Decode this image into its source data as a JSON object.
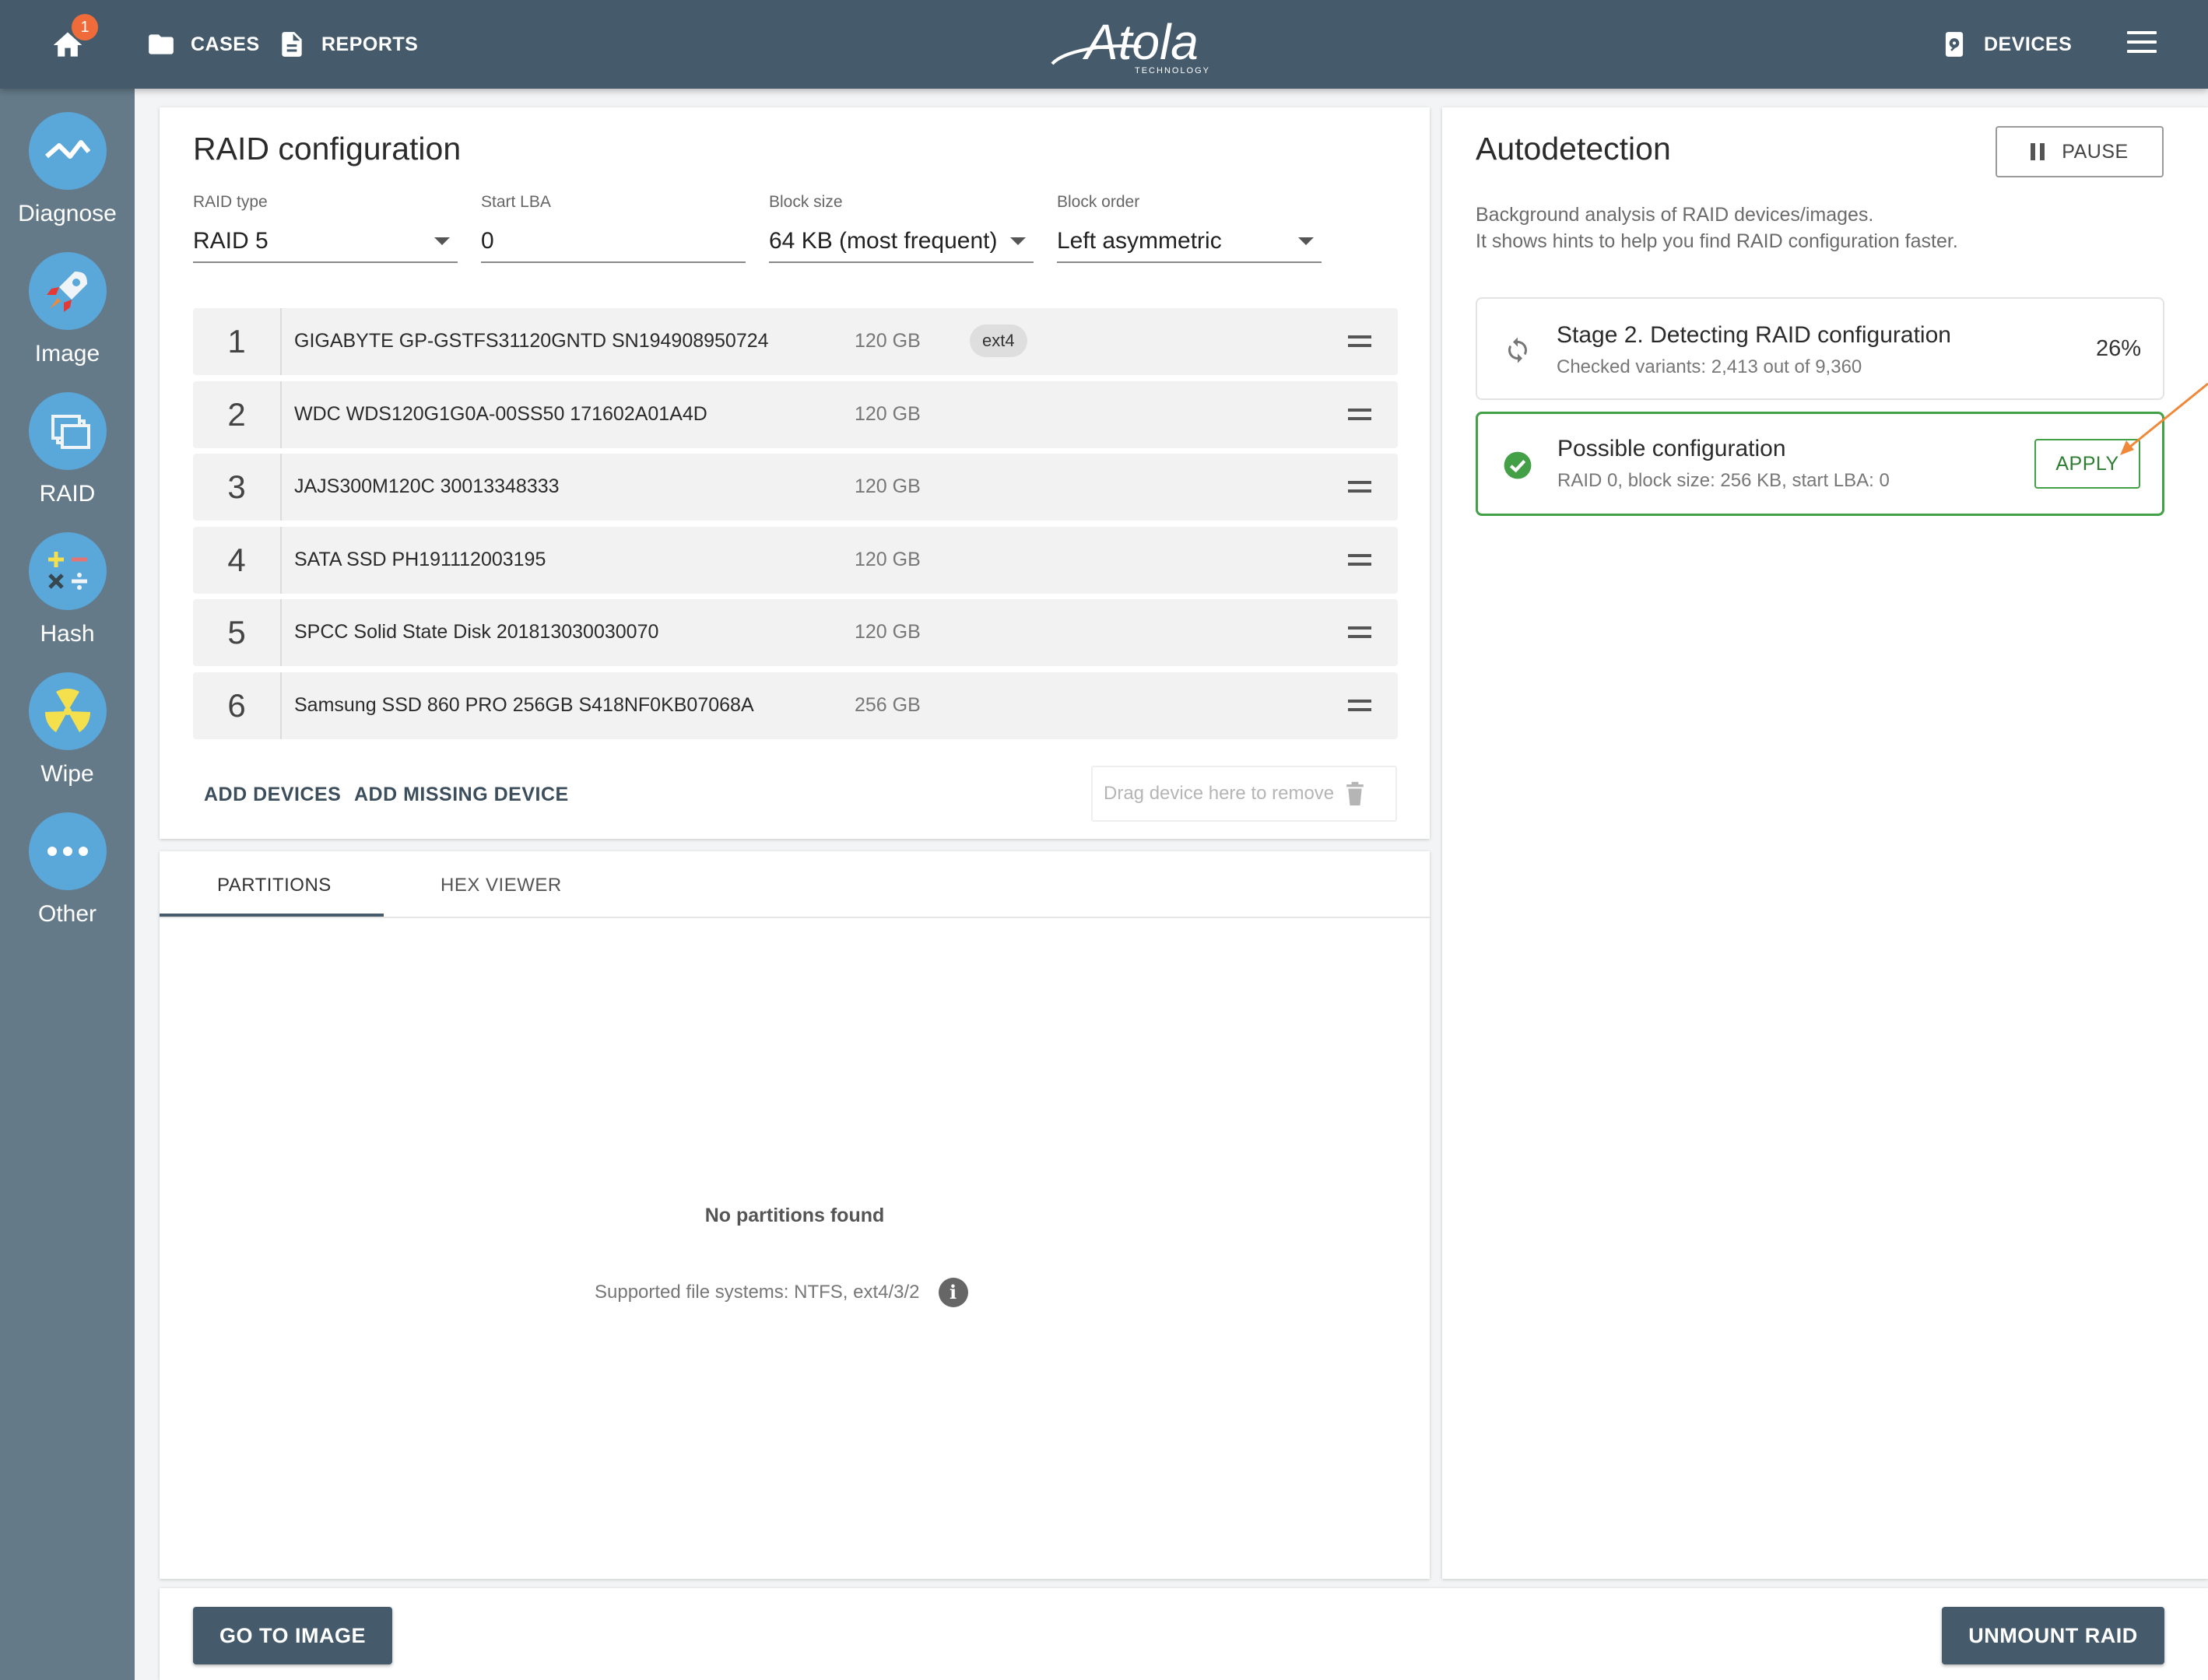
{
  "topbar": {
    "notification_count": "1",
    "cases_label": "CASES",
    "reports_label": "REPORTS",
    "logo_text": "Atola",
    "logo_subtext": "TECHNOLOGY",
    "devices_label": "DEVICES",
    "accent_color": "#455a6b",
    "badge_color": "#ef6c3a"
  },
  "sidebar": {
    "items": [
      {
        "label": "Diagnose",
        "icon": "diagnose-icon"
      },
      {
        "label": "Image",
        "icon": "rocket-icon"
      },
      {
        "label": "RAID",
        "icon": "raid-icon"
      },
      {
        "label": "Hash",
        "icon": "hash-icon"
      },
      {
        "label": "Wipe",
        "icon": "radiation-icon"
      },
      {
        "label": "Other",
        "icon": "more-icon"
      }
    ]
  },
  "raid": {
    "title": "RAID configuration",
    "fields": {
      "raid_type": {
        "label": "RAID type",
        "value": "RAID 5"
      },
      "start_lba": {
        "label": "Start LBA",
        "value": "0"
      },
      "block_size": {
        "label": "Block size",
        "value": "64 KB (most frequent)"
      },
      "block_order": {
        "label": "Block order",
        "value": "Left asymmetric"
      }
    },
    "devices": [
      {
        "num": "1",
        "name": "GIGABYTE GP-GSTFS31120GNTD SN194908950724",
        "size": "120 GB",
        "fs": "ext4"
      },
      {
        "num": "2",
        "name": "WDC WDS120G1G0A-00SS50 171602A01A4D",
        "size": "120 GB"
      },
      {
        "num": "3",
        "name": "JAJS300M120C 30013348333",
        "size": "120 GB"
      },
      {
        "num": "4",
        "name": "SATA SSD PH191112003195",
        "size": "120 GB"
      },
      {
        "num": "5",
        "name": "SPCC Solid State Disk 201813030030070",
        "size": "120 GB"
      },
      {
        "num": "6",
        "name": "Samsung SSD 860 PRO 256GB S418NF0KB07068A",
        "size": "256 GB"
      }
    ],
    "add_devices_label": "ADD DEVICES",
    "add_missing_label": "ADD MISSING DEVICE",
    "drop_zone_text": "Drag device here to remove"
  },
  "tabs": {
    "partitions_label": "PARTITIONS",
    "hex_viewer_label": "HEX VIEWER",
    "empty_title": "No partitions found",
    "empty_sub": "Supported file systems: NTFS, ext4/3/2"
  },
  "autodetect": {
    "title": "Autodetection",
    "pause_label": "PAUSE",
    "desc_line1": "Background analysis of RAID devices/images.",
    "desc_line2": "It shows hints to help you find RAID configuration faster.",
    "stage_title": "Stage 2. Detecting RAID configuration",
    "stage_sub": "Checked variants: 2,413 out of 9,360",
    "stage_percent": "26%",
    "possible_title": "Possible configuration",
    "possible_sub": "RAID 0, block size: 256 KB, start LBA: 0",
    "apply_label": "APPLY",
    "success_color": "#43a047",
    "annotation_color": "#f0883a"
  },
  "footer": {
    "go_to_image_label": "GO TO IMAGE",
    "unmount_label": "UNMOUNT RAID"
  }
}
